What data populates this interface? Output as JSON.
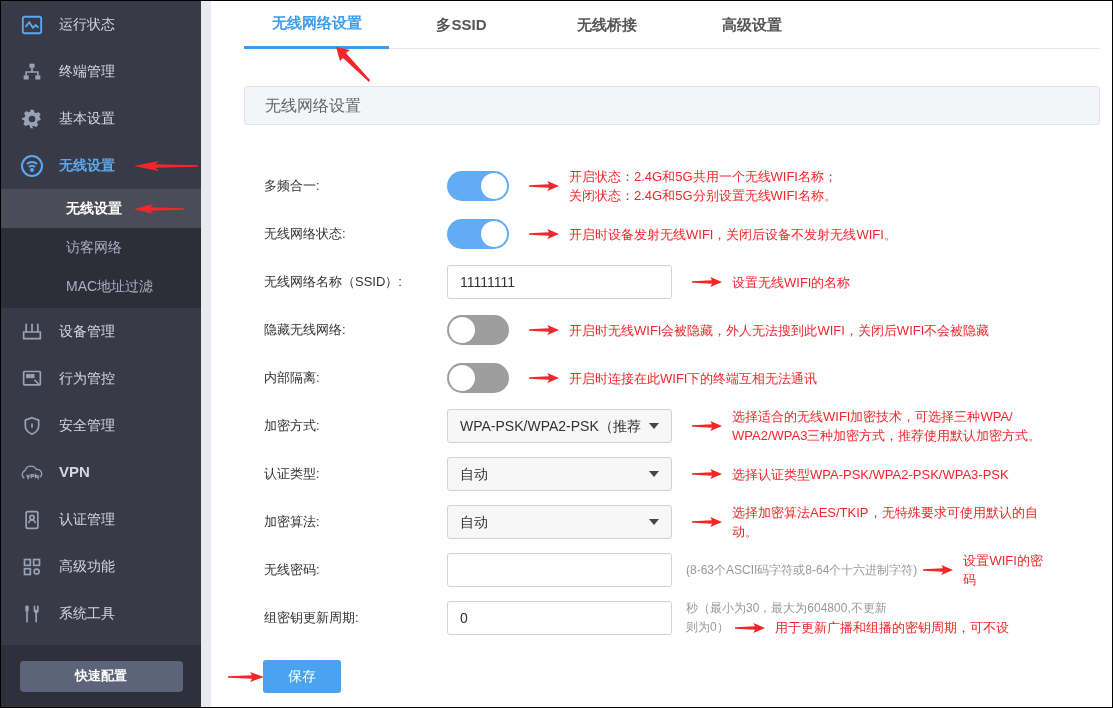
{
  "sidebar": {
    "items": [
      {
        "label": "运行状态",
        "selected": false,
        "arrow": false
      },
      {
        "label": "终端管理",
        "selected": false,
        "arrow": false
      },
      {
        "label": "基本设置",
        "selected": false,
        "arrow": false
      },
      {
        "label": "无线设置",
        "selected": true,
        "arrow": true,
        "children": [
          {
            "label": "无线设置",
            "selected": true,
            "arrow": true
          },
          {
            "label": "访客网络",
            "selected": false,
            "arrow": false
          },
          {
            "label": "MAC地址过滤",
            "selected": false,
            "arrow": false
          }
        ]
      },
      {
        "label": "设备管理",
        "selected": false,
        "arrow": false
      },
      {
        "label": "行为管控",
        "selected": false,
        "arrow": false
      },
      {
        "label": "安全管理",
        "selected": false,
        "arrow": false
      },
      {
        "label": "VPN",
        "selected": false,
        "arrow": false
      },
      {
        "label": "认证管理",
        "selected": false,
        "arrow": false
      },
      {
        "label": "高级功能",
        "selected": false,
        "arrow": false
      },
      {
        "label": "系统工具",
        "selected": false,
        "arrow": false
      }
    ],
    "quick_button": "快速配置"
  },
  "tabs": [
    {
      "label": "无线网络设置",
      "selected": true,
      "arrow": true
    },
    {
      "label": "多SSID",
      "selected": false,
      "arrow": false
    },
    {
      "label": "无线桥接",
      "selected": false,
      "arrow": false
    },
    {
      "label": "高级设置",
      "selected": false,
      "arrow": false
    }
  ],
  "section_title": "无线网络设置",
  "form": {
    "rows": [
      {
        "kind": "toggle",
        "label": "多频合一:",
        "on": true,
        "note": [
          "开启状态：2.4G和5G共用一个无线WIFI名称；",
          "关闭状态：2.4G和5G分别设置无线WIFI名称。"
        ]
      },
      {
        "kind": "toggle",
        "label": "无线网络状态:",
        "on": true,
        "note": [
          "开启时设备发射无线WIFI，关闭后设备不发射无线WIFI。"
        ]
      },
      {
        "kind": "text",
        "label": "无线网络名称（SSID）:",
        "value": "11111111",
        "note": [
          "设置无线WIFI的名称"
        ]
      },
      {
        "kind": "toggle",
        "label": "隐藏无线网络:",
        "on": false,
        "note": [
          "开启时无线WIFI会被隐藏，外人无法搜到此WIFI，关闭后WIFI不会被隐藏"
        ]
      },
      {
        "kind": "toggle",
        "label": "内部隔离:",
        "on": false,
        "note": [
          "开启时连接在此WIFI下的终端互相无法通讯"
        ]
      },
      {
        "kind": "select",
        "label": "加密方式:",
        "value": "WPA-PSK/WPA2-PSK（推荐",
        "note": [
          "选择适合的无线WIFI加密技术，可选择三种WPA/",
          "WPA2/WPA3三种加密方式，推荐使用默认加密方式。"
        ]
      },
      {
        "kind": "select",
        "label": "认证类型:",
        "value": "自动",
        "note": [
          "选择认证类型WPA-PSK/WPA2-PSK/WPA3-PSK"
        ]
      },
      {
        "kind": "select",
        "label": "加密算法:",
        "value": "自动",
        "note": [
          "选择加密算法AES/TKIP，无特殊要求可使用默认的自",
          "动。"
        ]
      },
      {
        "kind": "text",
        "label": "无线密码:",
        "value": "",
        "hint": [
          "(8-63个ASCII码字符或8-64个十六进制字符)"
        ],
        "note": [
          "设置WIFI的密",
          "码"
        ]
      },
      {
        "kind": "text",
        "label": "组密钥更新周期:",
        "value": "0",
        "hint": [
          "秒（最小为30，最大为604800,不更新",
          "则为0）"
        ],
        "note": [
          "用于更新广播和组播的密钥周期，可不设"
        ]
      }
    ]
  },
  "save_button": {
    "label": "保存",
    "arrow": true
  }
}
